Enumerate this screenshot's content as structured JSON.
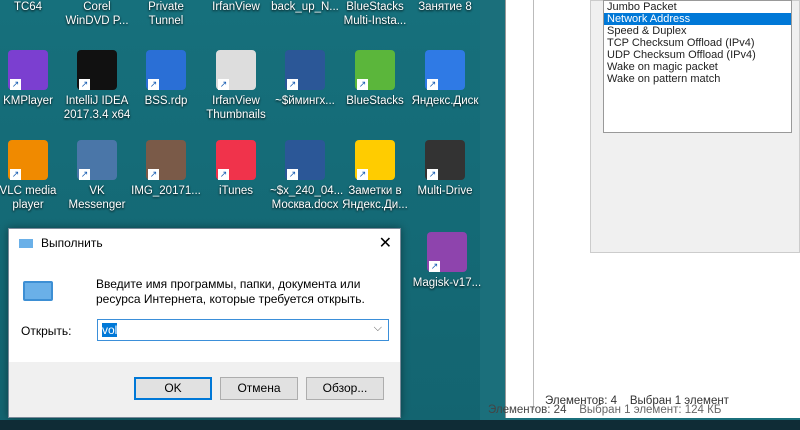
{
  "desktop_icons": [
    {
      "label": "TC64",
      "color": "#444"
    },
    {
      "label": "Corel WinDVD P...",
      "color": "#444"
    },
    {
      "label": "Private Tunnel",
      "color": "#444"
    },
    {
      "label": "IrfanView",
      "color": "#444"
    },
    {
      "label": "back_up_N...",
      "color": "#444"
    },
    {
      "label": "BlueStacks Multi-Insta...",
      "color": "#444"
    },
    {
      "label": "Занятие 8",
      "color": "#444"
    },
    {
      "label": "KMPlayer",
      "color": "#7b3fd0"
    },
    {
      "label": "IntelliJ IDEA 2017.3.4 x64",
      "color": "#111"
    },
    {
      "label": "BSS.rdp",
      "color": "#2a6fd6"
    },
    {
      "label": "IrfanView Thumbnails",
      "color": "#ddd"
    },
    {
      "label": "~$ймингх...",
      "color": "#2b5797"
    },
    {
      "label": "BlueStacks",
      "color": "#5bb63b"
    },
    {
      "label": "Яндекс.Диск",
      "color": "#2f7ae5"
    },
    {
      "label": "VLC media player",
      "color": "#f08a00"
    },
    {
      "label": "VK Messenger",
      "color": "#4a76a8"
    },
    {
      "label": "IMG_20171...",
      "color": "#7a5a48"
    },
    {
      "label": "iTunes",
      "color": "#f0334b"
    },
    {
      "label": "~$x_240_04... Москва.docx",
      "color": "#2b5797"
    },
    {
      "label": "Заметки в Яндекс.Ди...",
      "color": "#ffcc00"
    },
    {
      "label": "Multi-Drive",
      "color": "#333"
    },
    {
      "label": "Magisk-v17...",
      "color": "#8e44ad"
    }
  ],
  "run_dialog": {
    "title": "Выполнить",
    "prompt": "Введите имя программы, папки, документа или ресурса Интернета, которые требуется открыть.",
    "open_label": "Открыть:",
    "input_value": "vol",
    "ok": "OK",
    "cancel": "Отмена",
    "browse": "Обзор..."
  },
  "properties_list": {
    "items": [
      "Jumbo Packet",
      "Network Address",
      "Speed & Duplex",
      "TCP Checksum Offload (IPv4)",
      "UDP Checksum Offload (IPv4)",
      "Wake on magic packet",
      "Wake on pattern match"
    ],
    "selected": "Network Address"
  },
  "explorer_front": {
    "count": "Элементов: 4",
    "selected": "Выбран 1 элемент"
  },
  "explorer_back": {
    "count": "Элементов: 24",
    "selected": "Выбран 1 элемент: 124 КБ"
  }
}
